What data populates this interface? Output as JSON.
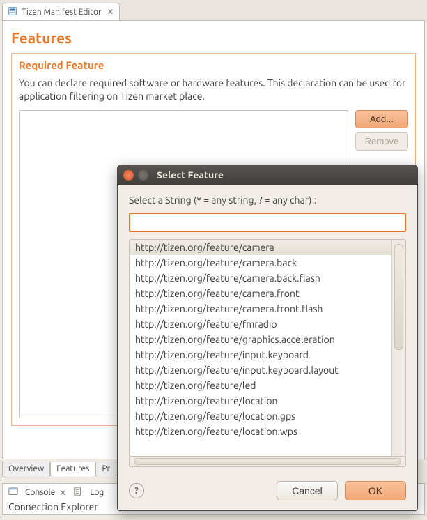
{
  "editor": {
    "tab_label": "Tizen Manifest Editor",
    "heading": "Features",
    "section_title": "Required Feature",
    "description": "You can declare required software or hardware features. This declaration can be used for application filtering on Tizen market place.",
    "add_label": "Add...",
    "remove_label": "Remove",
    "bottom_tabs": [
      "Overview",
      "Features",
      "Pr"
    ]
  },
  "panels": {
    "console_label": "Console",
    "log_label": "Log",
    "connection_explorer": "Connection Explorer"
  },
  "dialog": {
    "title": "Select Feature",
    "prompt": "Select a String (* = any string, ? = any char) :",
    "input_value": "",
    "items": [
      "http://tizen.org/feature/camera",
      "http://tizen.org/feature/camera.back",
      "http://tizen.org/feature/camera.back.flash",
      "http://tizen.org/feature/camera.front",
      "http://tizen.org/feature/camera.front.flash",
      "http://tizen.org/feature/fmradio",
      "http://tizen.org/feature/graphics.acceleration",
      "http://tizen.org/feature/input.keyboard",
      "http://tizen.org/feature/input.keyboard.layout",
      "http://tizen.org/feature/led",
      "http://tizen.org/feature/location",
      "http://tizen.org/feature/location.gps",
      "http://tizen.org/feature/location.wps"
    ],
    "selected_index": 0,
    "cancel_label": "Cancel",
    "ok_label": "OK"
  }
}
